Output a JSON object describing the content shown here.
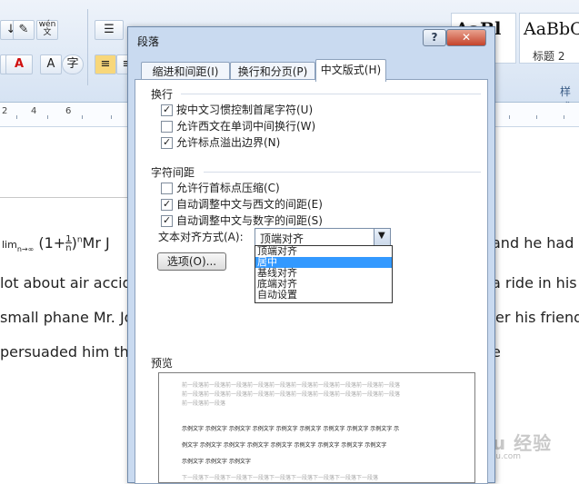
{
  "ribbon": {
    "style_samples": [
      {
        "sample": "AaBl",
        "name": ""
      },
      {
        "sample": "AaBbC",
        "name": "标题 2"
      }
    ],
    "style_group_label": "样式",
    "icons": {
      "wen": "wén\n文"
    }
  },
  "ruler": {
    "numbers": [
      "2",
      "4",
      "6"
    ]
  },
  "document": {
    "line1_left": "lim",
    "line1_sub": "n→∞",
    "line1_formula": "(1+",
    "line1_frac_num": "1",
    "line1_frac_den": "n",
    "line1_close": ")",
    "line1_sup": "n",
    "line1_text": "Mr J",
    "line1_right": "and he had re",
    "line2_left": "lot about air accide",
    "line2_right": "a ride in his",
    "line3_left": "small phane Mr. Jol",
    "line3_right": "er  his friend",
    "line4_left": "persuaded him tha",
    "line4_right": "e"
  },
  "dialog": {
    "title": "段落",
    "help_label": "?",
    "close_label": "✕",
    "tabs": [
      {
        "label": "缩进和间距(I)"
      },
      {
        "label": "换行和分页(P)"
      },
      {
        "label": "中文版式(H)"
      }
    ],
    "line_break_group": {
      "label": "换行",
      "options": [
        {
          "label": "按中文习惯控制首尾字符(U)",
          "checked": true
        },
        {
          "label": "允许西文在单词中间换行(W)",
          "checked": false
        },
        {
          "label": "允许标点溢出边界(N)",
          "checked": true
        }
      ]
    },
    "spacing_group": {
      "label": "字符间距",
      "options": [
        {
          "label": "允许行首标点压缩(C)",
          "checked": false
        },
        {
          "label": "自动调整中文与西文的间距(E)",
          "checked": true
        },
        {
          "label": "自动调整中文与数字的间距(S)",
          "checked": true
        }
      ]
    },
    "text_alignment": {
      "label": "文本对齐方式(A):",
      "value": "顶端对齐",
      "options": [
        "顶端对齐",
        "居中",
        "基线对齐",
        "底端对齐",
        "自动设置"
      ],
      "highlighted": "居中"
    },
    "options_button": "选项(O)...",
    "preview": {
      "label": "预览",
      "grey_line": "前一段落前一段落前一段落前一段落前一段落前一段落前一段落前一段落前一段落前一段落",
      "grey_short": "前一段落前一段落",
      "sample_line": "示例文字 示例文字 示例文字 示例文字 示例文字 示例文字 示例文字 示例文字 示例文字 示",
      "sample_line2": "例文字 示例文字 示例文字 示例文字 示例文字 示例文字 示例文字 示例文字 示例文字",
      "sample_short": "示例文字 示例文字 示例文字",
      "next_line": "下一段落下一段落下一段落下一段落下一段落下一段落下一段落下一段落下一段落"
    }
  },
  "watermark": {
    "text": "Baidu 经验",
    "sub": "jingyan.baidu.com"
  }
}
